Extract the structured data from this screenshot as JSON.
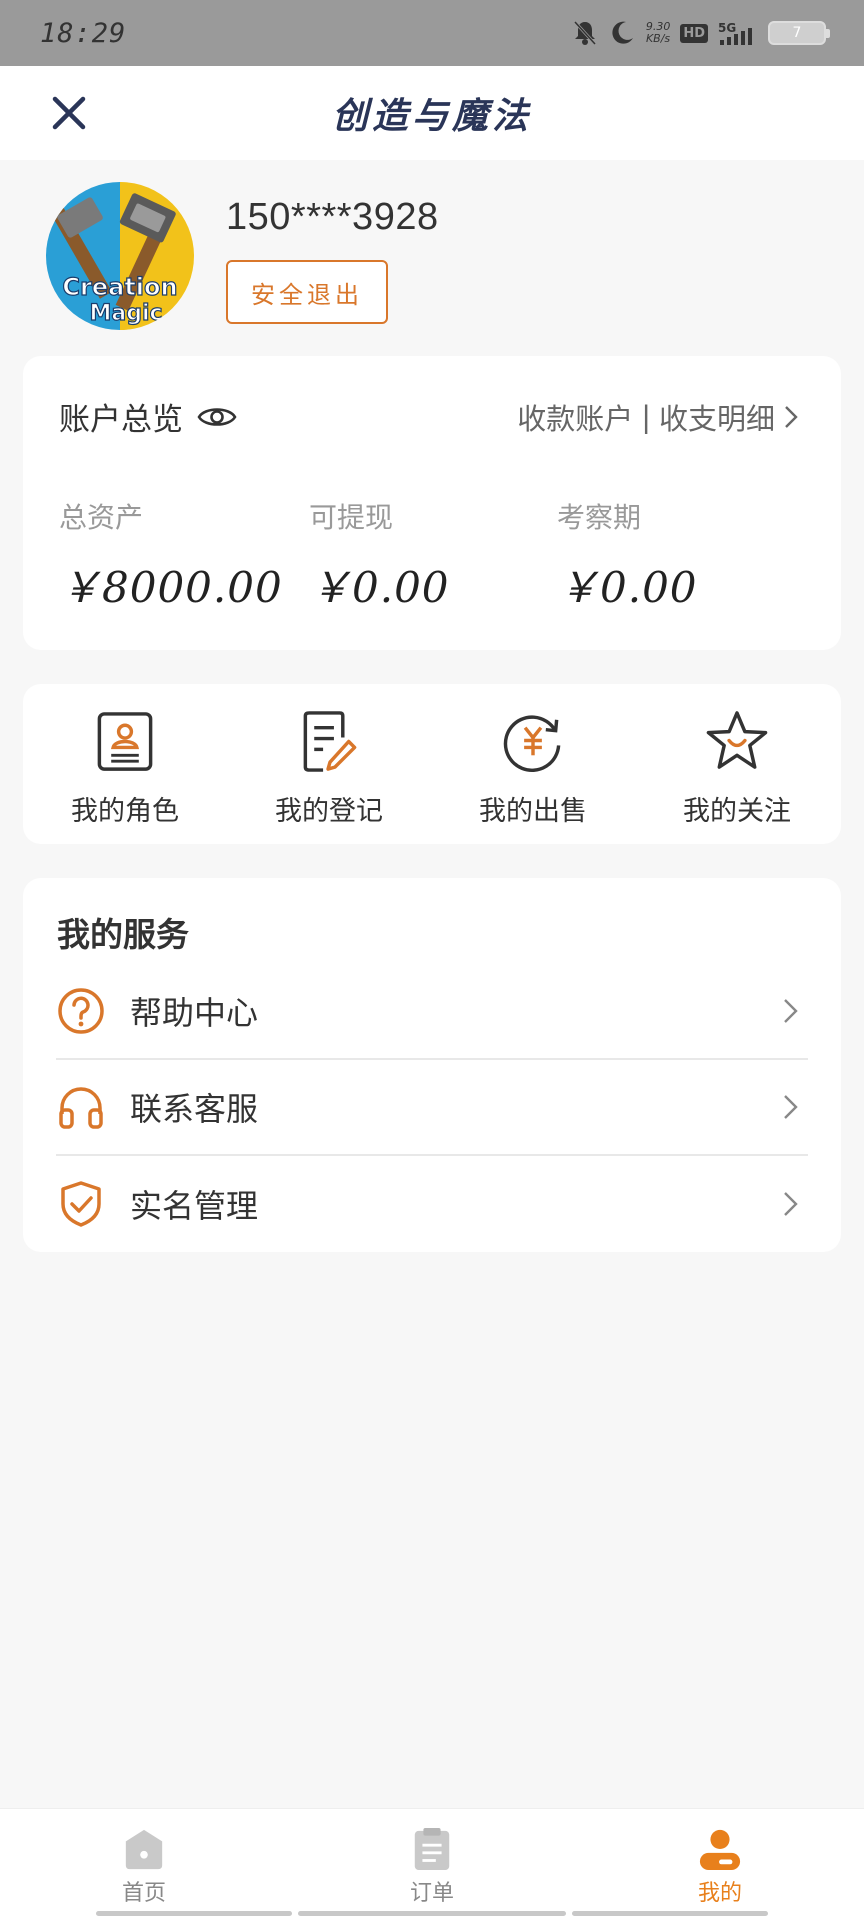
{
  "status_bar": {
    "time": "18:29",
    "net_speed_value": "9.30",
    "net_speed_unit": "KB/s",
    "hd": "HD",
    "signal": "5G",
    "battery": "7"
  },
  "header": {
    "title": "创造与魔法"
  },
  "profile": {
    "phone": "150****3928",
    "logout_label": "安全退出",
    "avatar_text_1": "Creation",
    "avatar_text_2": "Magic"
  },
  "account": {
    "title": "账户总览",
    "link_receive": "收款账户",
    "link_separator": "|",
    "link_detail": "收支明细",
    "stats": [
      {
        "label": "总资产",
        "value": "￥8000.00"
      },
      {
        "label": "可提现",
        "value": "￥0.00"
      },
      {
        "label": "考察期",
        "value": "￥0.00"
      }
    ]
  },
  "quick_actions": [
    {
      "label": "我的角色",
      "icon": "id-card-icon"
    },
    {
      "label": "我的登记",
      "icon": "edit-document-icon"
    },
    {
      "label": "我的出售",
      "icon": "yuan-refresh-icon"
    },
    {
      "label": "我的关注",
      "icon": "star-smile-icon"
    }
  ],
  "services": {
    "title": "我的服务",
    "items": [
      {
        "label": "帮助中心",
        "icon": "help-circle-icon"
      },
      {
        "label": "联系客服",
        "icon": "headphones-icon"
      },
      {
        "label": "实名管理",
        "icon": "shield-check-icon"
      }
    ]
  },
  "bottom_nav": {
    "items": [
      {
        "label": "首页",
        "icon": "home-icon",
        "active": false
      },
      {
        "label": "订单",
        "icon": "clipboard-icon",
        "active": false
      },
      {
        "label": "我的",
        "icon": "user-icon",
        "active": true
      }
    ]
  },
  "colors": {
    "accent": "#e8801c",
    "icon_orange": "#d9772b",
    "title_navy": "#2a3558",
    "background": "#f7f7f7"
  }
}
